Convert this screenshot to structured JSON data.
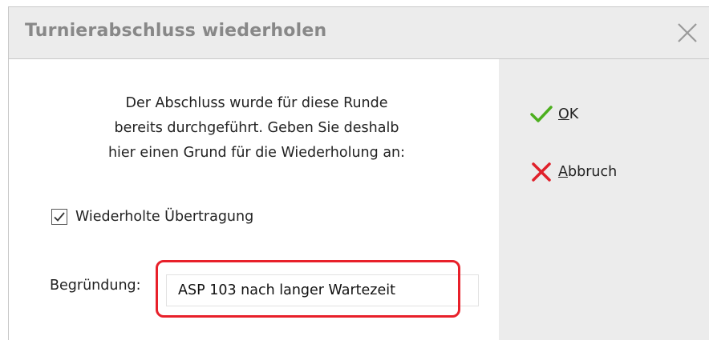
{
  "dialog": {
    "title": "Turnierabschluss wiederholen"
  },
  "message": {
    "lines": [
      "Der Abschluss wurde für diese Runde",
      "bereits durchgeführt. Geben Sie deshalb",
      "hier einen Grund für die Wiederholung an:"
    ]
  },
  "checkbox": {
    "label": "Wiederholte Übertragung",
    "checked": true
  },
  "reason": {
    "label": "Begründung:",
    "value": "ASP 103 nach langer Wartezeit"
  },
  "buttons": {
    "ok_label": "OK",
    "cancel_label": "Abbruch"
  },
  "colors": {
    "ok_check": "#4caf1e",
    "cancel_x": "#e0202a",
    "highlight": "#e8202a",
    "side_panel": "#ececec"
  },
  "icons": [
    "close-icon",
    "checkmark-icon",
    "cancel-x-icon",
    "checkbox-checked-icon"
  ]
}
